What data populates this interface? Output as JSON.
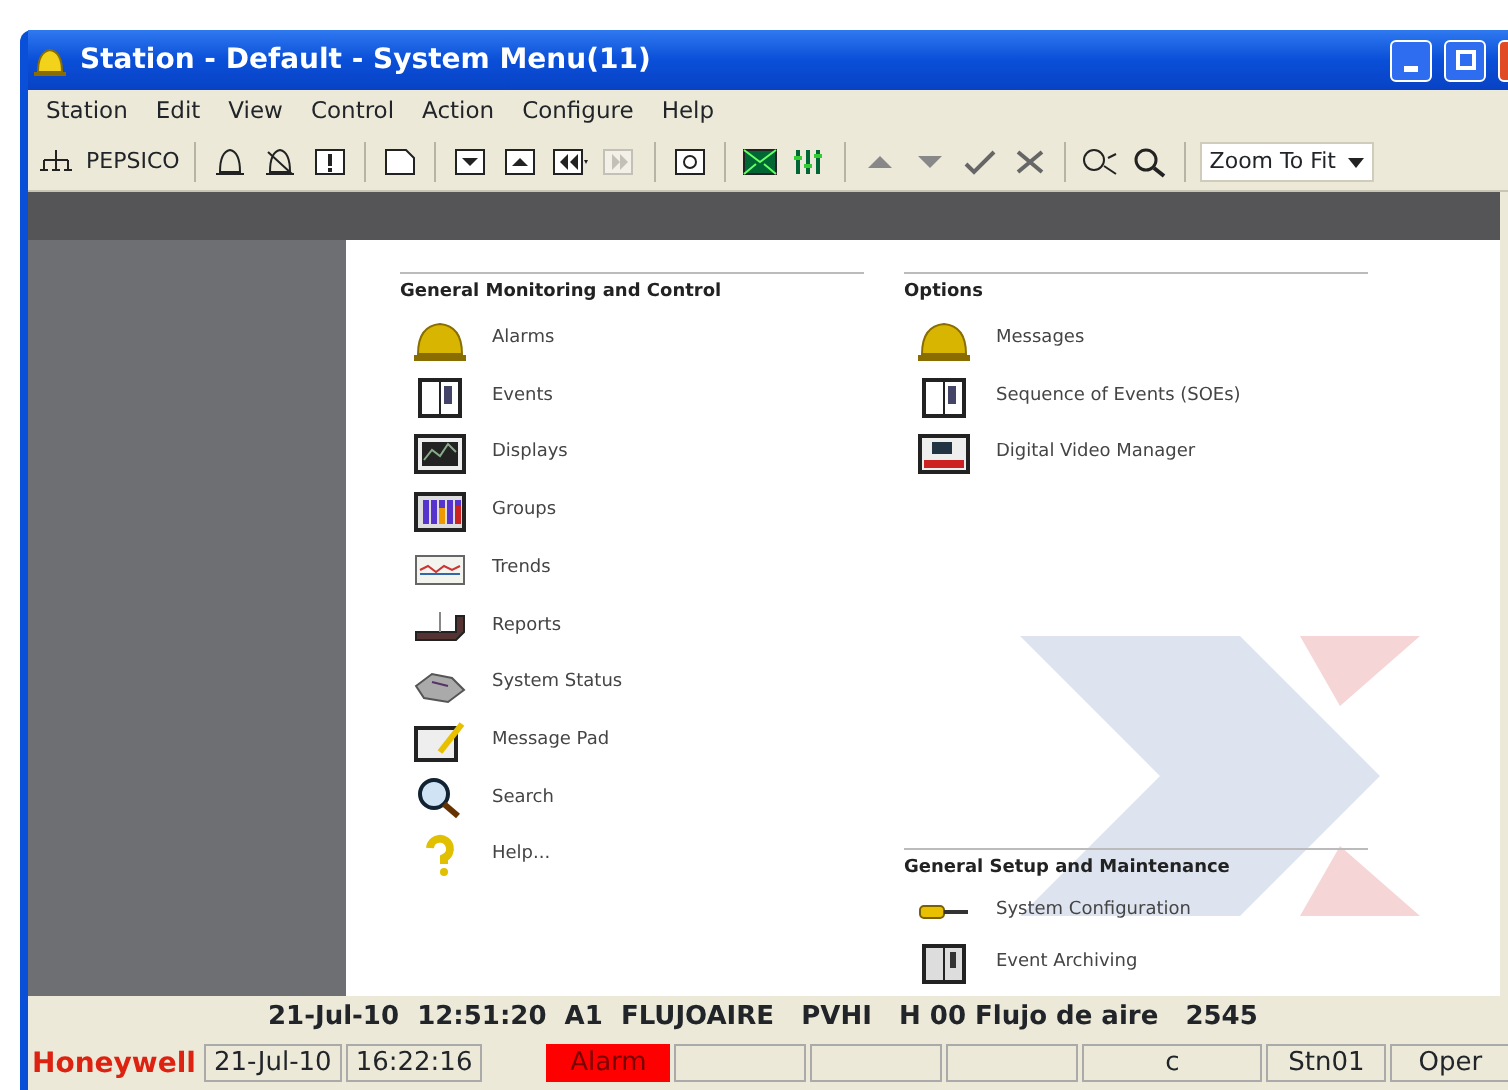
{
  "window": {
    "title": "Station - Default - System Menu(11)"
  },
  "menu_bar": [
    "Station",
    "Edit",
    "View",
    "Control",
    "Action",
    "Configure",
    "Help"
  ],
  "toolbar": {
    "station_label": "PEPSICO",
    "zoom": {
      "value": "Zoom To Fit"
    }
  },
  "sections": [
    {
      "title": "General Monitoring and Control",
      "items": [
        "Alarms",
        "Events",
        "Displays",
        "Groups",
        "Trends",
        "Reports",
        "System Status",
        "Message Pad",
        "Search",
        "Help..."
      ]
    },
    {
      "title": "Options",
      "items": [
        "Messages",
        "Sequence of Events (SOEs)",
        "Digital Video Manager"
      ]
    },
    {
      "title": "General Setup and Maintenance",
      "items": [
        "System Configuration",
        "Event Archiving"
      ]
    }
  ],
  "alarm_line": "21-Jul-10  12:51:20  A1  FLUJOAIRE   PVHI   H 00 Flujo de aire   2545",
  "status_bar": [
    {
      "kind": "brand",
      "text": "Honeywell"
    },
    {
      "kind": "text",
      "text": "21-Jul-10"
    },
    {
      "kind": "text",
      "text": "16:22:16"
    },
    {
      "kind": "alarm",
      "text": "Alarm"
    },
    {
      "kind": "blank"
    },
    {
      "kind": "blank"
    },
    {
      "kind": "blank"
    },
    {
      "kind": "text",
      "text": "c"
    },
    {
      "kind": "text",
      "text": "Stn01"
    },
    {
      "kind": "text",
      "text": "Oper"
    }
  ]
}
